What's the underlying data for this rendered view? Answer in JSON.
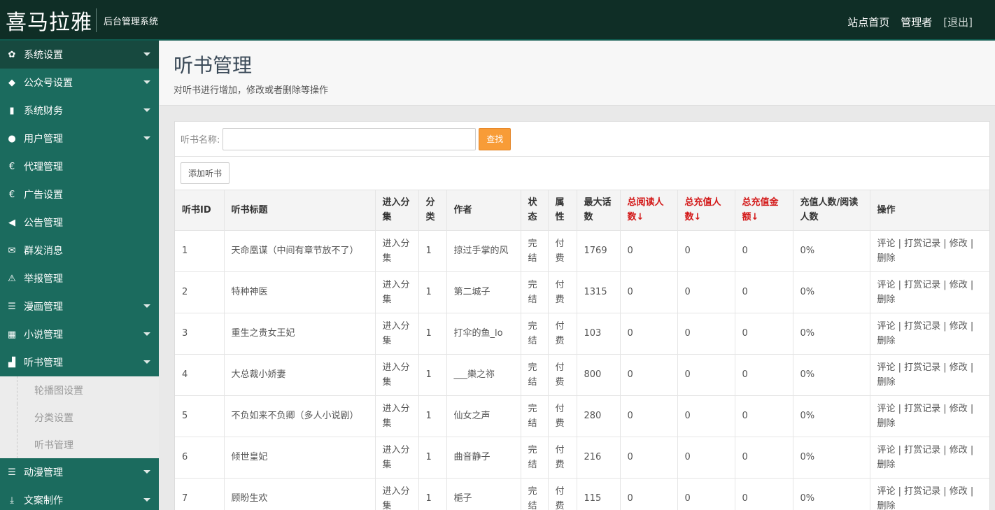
{
  "header": {
    "brand": "喜马拉雅",
    "subtitle": "后台管理系统",
    "links": [
      "站点首页",
      "管理者",
      "[退出]"
    ]
  },
  "sidebar": {
    "items": [
      {
        "label": "系统设置",
        "icon": "gear-icon",
        "glyph": "✿"
      },
      {
        "label": "公众号设置",
        "icon": "tags-icon",
        "glyph": "◆"
      },
      {
        "label": "系统财务",
        "icon": "bar-chart-icon",
        "glyph": "▮"
      },
      {
        "label": "用户管理",
        "icon": "user-icon",
        "glyph": "●"
      },
      {
        "label": "代理管理",
        "icon": "euro-icon",
        "glyph": "€"
      },
      {
        "label": "广告设置",
        "icon": "euro-icon",
        "glyph": "€"
      },
      {
        "label": "公告管理",
        "icon": "megaphone-icon",
        "glyph": "◀"
      },
      {
        "label": "群发消息",
        "icon": "envelope-icon",
        "glyph": "✉"
      },
      {
        "label": "举报管理",
        "icon": "warning-icon",
        "glyph": "⚠"
      },
      {
        "label": "漫画管理",
        "icon": "list-icon",
        "glyph": "☰"
      },
      {
        "label": "小说管理",
        "icon": "grid-icon",
        "glyph": "▦"
      },
      {
        "label": "听书管理",
        "icon": "sitemap-icon",
        "glyph": "▟"
      }
    ],
    "submenu": [
      "轮播图设置",
      "分类设置",
      "听书管理"
    ],
    "items_after": [
      {
        "label": "动漫管理",
        "icon": "list-icon",
        "glyph": "☰"
      },
      {
        "label": "文案制作",
        "icon": "download-icon",
        "glyph": "⤓"
      }
    ]
  },
  "page": {
    "title": "听书管理",
    "description": "对听书进行增加，修改或者删除等操作"
  },
  "search": {
    "label": "听书名称:",
    "placeholder": "",
    "button": "查找"
  },
  "add_button": "添加听书",
  "table": {
    "headers": [
      "听书ID",
      "听书标题",
      "进入分集",
      "分类",
      "作者",
      "状态",
      "属性",
      "最大话数",
      "总阅读人数↓",
      "总充值人数↓",
      "总充值金额↓",
      "充值人数/阅读人数",
      "操作"
    ],
    "rows": [
      [
        "1",
        "天命凰谋（中间有章节放不了）",
        "进入分集",
        "1",
        "掠过手掌的风",
        "完结",
        "付费",
        "1769",
        "0",
        "0",
        "0",
        "0%",
        "评论 | 打赏记录 | 修改 | 删除"
      ],
      [
        "2",
        "特种神医",
        "进入分集",
        "1",
        "第二城子",
        "完结",
        "付费",
        "1315",
        "0",
        "0",
        "0",
        "0%",
        "评论 | 打赏记录 | 修改 | 删除"
      ],
      [
        "3",
        "重生之贵女王妃",
        "进入分集",
        "1",
        "打伞的鱼_lo",
        "完结",
        "付费",
        "103",
        "0",
        "0",
        "0",
        "0%",
        "评论 | 打赏记录 | 修改 | 删除"
      ],
      [
        "4",
        "大总裁小娇妻",
        "进入分集",
        "1",
        "___樂之祢",
        "完结",
        "付费",
        "800",
        "0",
        "0",
        "0",
        "0%",
        "评论 | 打赏记录 | 修改 | 删除"
      ],
      [
        "5",
        "不负如来不负卿（多人小说剧）",
        "进入分集",
        "1",
        "仙女之声",
        "完结",
        "付费",
        "280",
        "0",
        "0",
        "0",
        "0%",
        "评论 | 打赏记录 | 修改 | 删除"
      ],
      [
        "6",
        "倾世皇妃",
        "进入分集",
        "1",
        "曲音静子",
        "完结",
        "付费",
        "216",
        "0",
        "0",
        "0",
        "0%",
        "评论 | 打赏记录 | 修改 | 删除"
      ],
      [
        "7",
        "顾盼生欢",
        "进入分集",
        "1",
        "梔子",
        "完结",
        "付费",
        "115",
        "0",
        "0",
        "0",
        "0%",
        "评论 | 打赏记录 | 修改 | 删除"
      ]
    ]
  }
}
